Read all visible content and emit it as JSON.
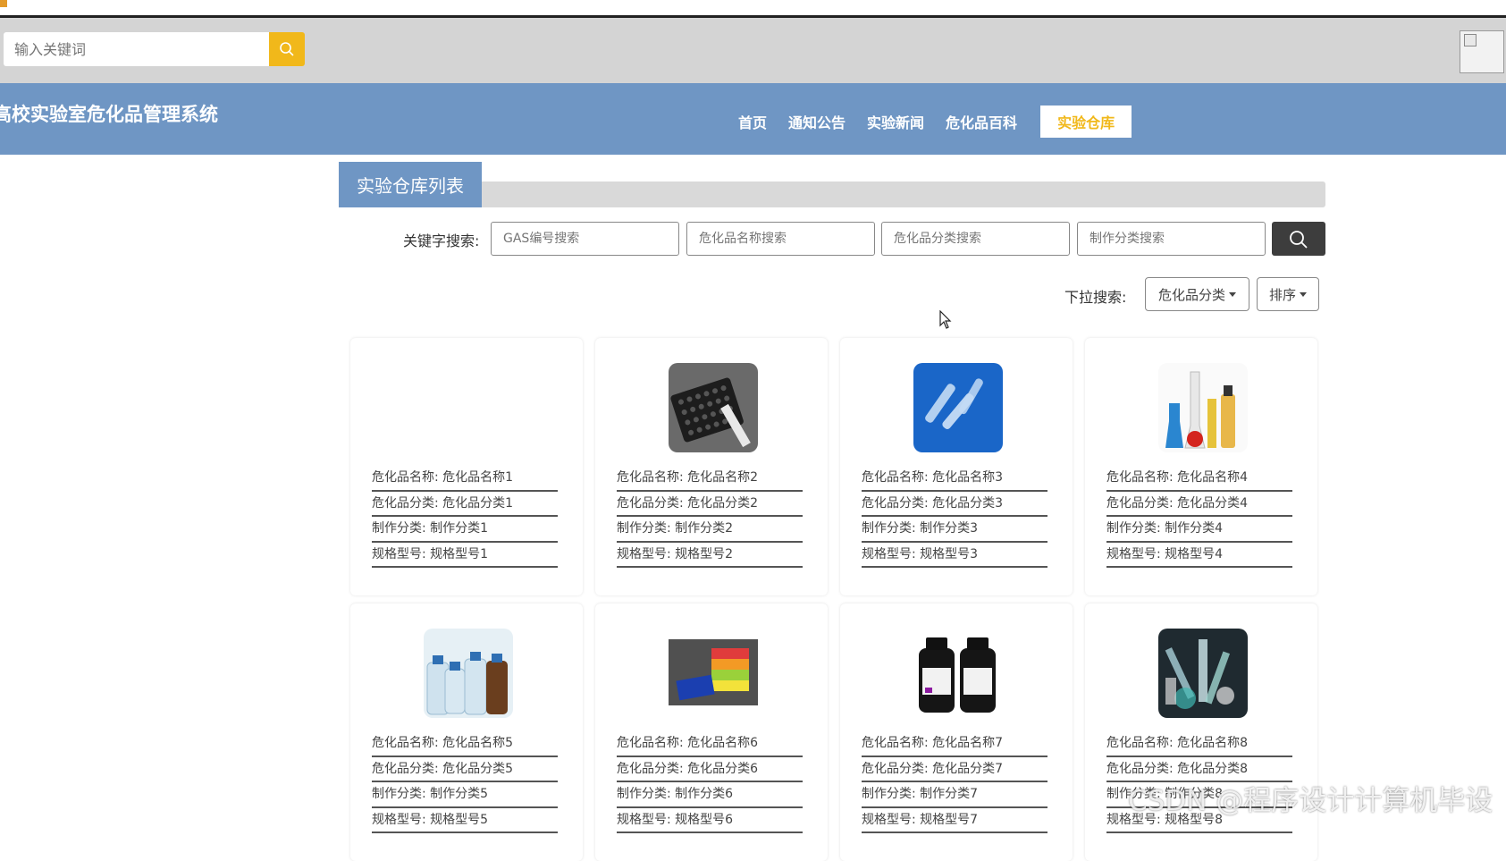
{
  "search": {
    "placeholder": "输入关键词"
  },
  "header": {
    "site_title": "高校实验室危化品管理系统",
    "nav": [
      "首页",
      "通知公告",
      "实验新闻",
      "危化品百科",
      "实验仓库"
    ],
    "active_index": 4
  },
  "section": {
    "title": "实验仓库列表"
  },
  "filters": {
    "label": "关键字搜索:",
    "inputs": [
      "GAS编号搜索",
      "危化品名称搜索",
      "危化品分类搜索",
      "制作分类搜索"
    ]
  },
  "dropdowns": {
    "label": "下拉搜索:",
    "category": "危化品分类",
    "sort": "排序"
  },
  "colors": {
    "nav_bg": "#6f96c4",
    "accent": "#f1b81a",
    "topbar_bg": "#d4d4d4"
  },
  "products": [
    {
      "name": "危化品名称: 危化品名称1",
      "category": "危化品分类: 危化品分类1",
      "make": "制作分类: 制作分类1",
      "spec": "规格型号: 规格型号1",
      "image": "none"
    },
    {
      "name": "危化品名称: 危化品名称2",
      "category": "危化品分类: 危化品分类2",
      "make": "制作分类: 制作分类2",
      "spec": "规格型号: 规格型号2",
      "image": "black-tube-rack"
    },
    {
      "name": "危化品名称: 危化品名称3",
      "category": "危化品分类: 危化品分类3",
      "make": "制作分类: 制作分类3",
      "spec": "规格型号: 规格型号3",
      "image": "clear-tubes-on-blue"
    },
    {
      "name": "危化品名称: 危化品名称4",
      "category": "危化品分类: 危化品分类4",
      "make": "制作分类: 制作分类4",
      "spec": "规格型号: 规格型号4",
      "image": "colored-flasks"
    },
    {
      "name": "危化品名称: 危化品名称5",
      "category": "危化品分类: 危化品分类5",
      "make": "制作分类: 制作分类5",
      "spec": "规格型号: 规格型号5",
      "image": "reagent-bottles"
    },
    {
      "name": "危化品名称: 危化品名称6",
      "category": "危化品分类: 危化品分类6",
      "make": "制作分类: 制作分类6",
      "spec": "规格型号: 规格型号6",
      "image": "colored-tip-boxes"
    },
    {
      "name": "危化品名称: 危化品名称7",
      "category": "危化品分类: 危化品分类7",
      "make": "制作分类: 制作分类7",
      "spec": "规格型号: 规格型号7",
      "image": "black-chemical-bottles"
    },
    {
      "name": "危化品名称: 危化品名称8",
      "category": "危化品分类: 危化品分类8",
      "make": "制作分类: 制作分类8",
      "spec": "规格型号: 规格型号8",
      "image": "lab-plasticware"
    }
  ],
  "watermark": "CSDN @程序设计计算机毕设"
}
